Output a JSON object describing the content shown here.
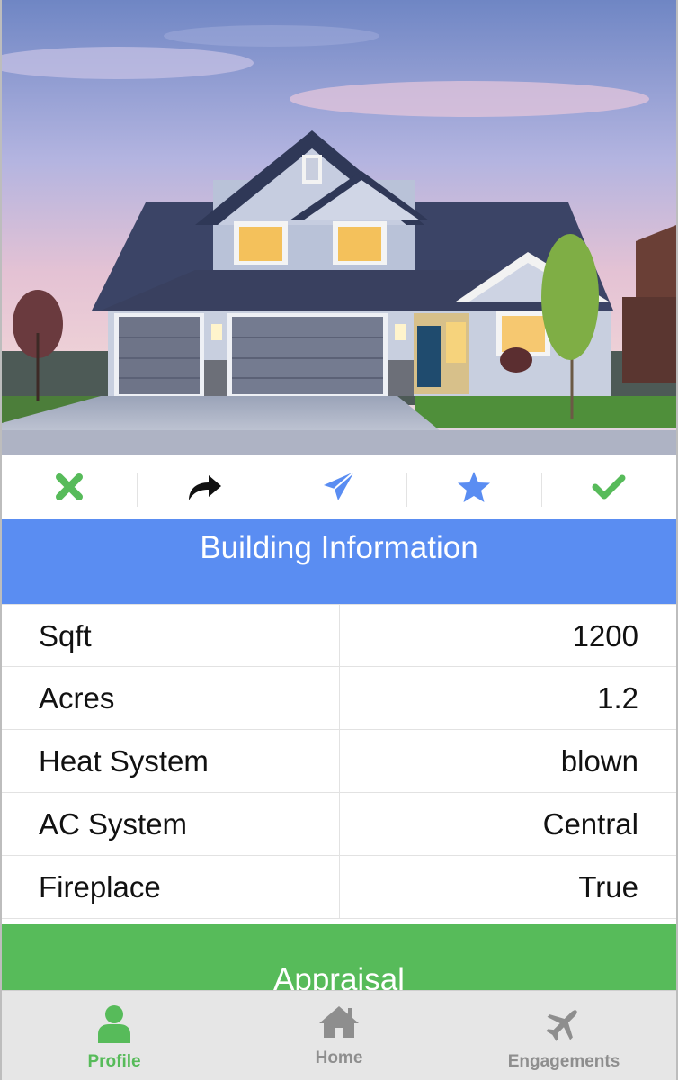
{
  "hero": {
    "image": "two-story suburban house at dusk with garage"
  },
  "actions": [
    {
      "icon": "close-icon",
      "color": "#57bb5a"
    },
    {
      "icon": "share-icon",
      "color": "#111111"
    },
    {
      "icon": "send-icon",
      "color": "#5a8df2"
    },
    {
      "icon": "star-icon",
      "color": "#5a8df2"
    },
    {
      "icon": "check-icon",
      "color": "#57bb5a"
    }
  ],
  "section": {
    "title": "Building Information",
    "color": "#5a8df2"
  },
  "rows": [
    {
      "label": "Sqft",
      "value": "1200"
    },
    {
      "label": "Acres",
      "value": "1.2"
    },
    {
      "label": "Heat System",
      "value": "blown"
    },
    {
      "label": "AC System",
      "value": "Central"
    },
    {
      "label": "Fireplace",
      "value": "True"
    }
  ],
  "appraisal": {
    "label": "Appraisal",
    "color": "#57bb5a"
  },
  "tabs": [
    {
      "label": "Profile",
      "icon": "profile-icon",
      "active": true
    },
    {
      "label": "Home",
      "icon": "home-icon",
      "active": false
    },
    {
      "label": "Engagements",
      "icon": "airplane-icon",
      "active": false
    }
  ]
}
